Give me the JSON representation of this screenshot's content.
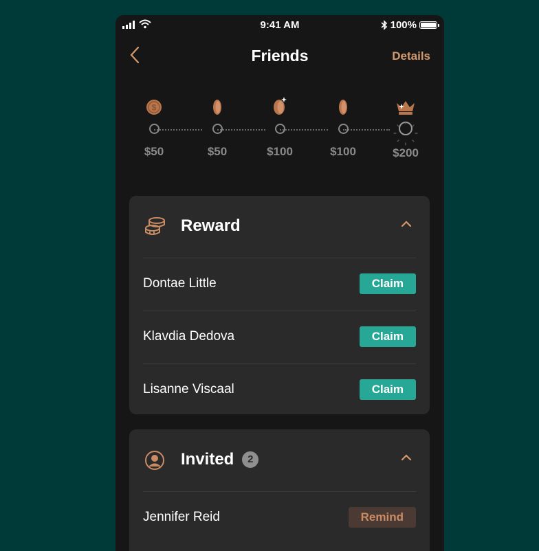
{
  "status_bar": {
    "time": "9:41 AM",
    "battery": "100%"
  },
  "header": {
    "title": "Friends",
    "details_label": "Details"
  },
  "milestones": [
    {
      "amount": "$50",
      "icon": "dollar-coin-icon"
    },
    {
      "amount": "$50",
      "icon": "coin-icon"
    },
    {
      "amount": "$100",
      "icon": "sparkle-coin-icon"
    },
    {
      "amount": "$100",
      "icon": "coin-icon"
    },
    {
      "amount": "$200",
      "icon": "crown-icon"
    }
  ],
  "reward": {
    "title": "Reward",
    "items": [
      {
        "name": "Dontae Little",
        "action": "Claim"
      },
      {
        "name": "Klavdia Dedova",
        "action": "Claim"
      },
      {
        "name": "Lisanne Viscaal",
        "action": "Claim"
      }
    ]
  },
  "invited": {
    "title": "Invited",
    "count": "2",
    "items": [
      {
        "name": "Jennifer Reid",
        "action": "Remind"
      }
    ]
  },
  "colors": {
    "accent": "#d49a6e",
    "claim": "#27a796",
    "background": "#003a38",
    "card": "#2a2a2a"
  }
}
